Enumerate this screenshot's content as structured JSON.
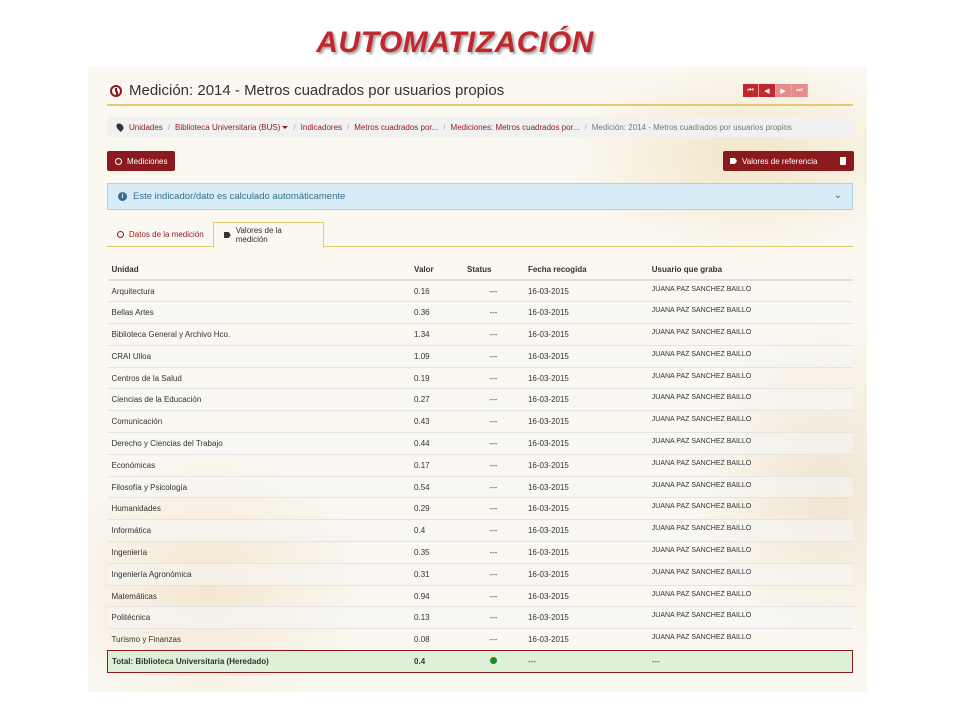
{
  "slide_title": "AUTOMATIZACIÓN",
  "header": {
    "title": "Medición: 2014 - Metros cuadrados por usuarios propios",
    "pager": [
      "⏮",
      "◀",
      "▶",
      "⏭"
    ]
  },
  "breadcrumb": {
    "items": [
      "Unidades",
      "Biblioteca Universitaria (BUS)",
      "Indicadores",
      "Metros cuadrados por...",
      "Mediciones: Metros cuadrados por..."
    ],
    "current": "Medición: 2014 - Metros cuadrados por usuarios propios"
  },
  "buttons": {
    "mediciones": "Mediciones",
    "valores_referencia": "Valores de referencia"
  },
  "alert": {
    "text": "Este indicador/dato es calculado automáticamente"
  },
  "tabs": [
    "Datos de la medición",
    "Valores de la medición"
  ],
  "table": {
    "headers": [
      "Unidad",
      "Valor",
      "Status",
      "Fecha recogida",
      "Usuario que graba"
    ],
    "rows": [
      [
        "Arquitectura",
        "0.16",
        "---",
        "16-03-2015",
        "JUANA PAZ SANCHEZ BAILLO"
      ],
      [
        "Bellas Artes",
        "0.36",
        "---",
        "16-03-2015",
        "JUANA PAZ SANCHEZ BAILLO"
      ],
      [
        "Biblioteca General y Archivo Hco.",
        "1.34",
        "---",
        "16-03-2015",
        "JUANA PAZ SANCHEZ BAILLO"
      ],
      [
        "CRAI Ulloa",
        "1.09",
        "---",
        "16-03-2015",
        "JUANA PAZ SANCHEZ BAILLO"
      ],
      [
        "Centros de la Salud",
        "0.19",
        "---",
        "16-03-2015",
        "JUANA PAZ SANCHEZ BAILLO"
      ],
      [
        "Ciencias de la Educación",
        "0.27",
        "---",
        "16-03-2015",
        "JUANA PAZ SANCHEZ BAILLO"
      ],
      [
        "Comunicación",
        "0.43",
        "---",
        "16-03-2015",
        "JUANA PAZ SANCHEZ BAILLO"
      ],
      [
        "Derecho y Ciencias del Trabajo",
        "0.44",
        "---",
        "16-03-2015",
        "JUANA PAZ SANCHEZ BAILLO"
      ],
      [
        "Económicas",
        "0.17",
        "---",
        "16-03-2015",
        "JUANA PAZ SANCHEZ BAILLO"
      ],
      [
        "Filosofía y Psicología",
        "0.54",
        "---",
        "16-03-2015",
        "JUANA PAZ SANCHEZ BAILLO"
      ],
      [
        "Humanidades",
        "0.29",
        "---",
        "16-03-2015",
        "JUANA PAZ SANCHEZ BAILLO"
      ],
      [
        "Informática",
        "0.4",
        "---",
        "16-03-2015",
        "JUANA PAZ SANCHEZ BAILLO"
      ],
      [
        "Ingeniería",
        "0.35",
        "---",
        "16-03-2015",
        "JUANA PAZ SANCHEZ BAILLO"
      ],
      [
        "Ingeniería Agronómica",
        "0.31",
        "---",
        "16-03-2015",
        "JUANA PAZ SANCHEZ BAILLO"
      ],
      [
        "Matemáticas",
        "0.94",
        "---",
        "16-03-2015",
        "JUANA PAZ SANCHEZ BAILLO"
      ],
      [
        "Politécnica",
        "0.13",
        "---",
        "16-03-2015",
        "JUANA PAZ SANCHEZ BAILLO"
      ],
      [
        "Turismo y Finanzas",
        "0.08",
        "---",
        "16-03-2015",
        "JUANA PAZ SANCHEZ BAILLO"
      ]
    ],
    "total": {
      "label": "Total: Biblioteca Universitaria (Heredado)",
      "value": "0.4",
      "status_icon": "green-dot-icon",
      "fecha": "---",
      "usuario": "---"
    }
  },
  "colors": {
    "accent": "#8b1a1f",
    "title_red": "#c0282d",
    "alert_bg": "#d8ecf7",
    "total_bg": "#dff0d8",
    "status_ok": "#1f8c1f"
  }
}
